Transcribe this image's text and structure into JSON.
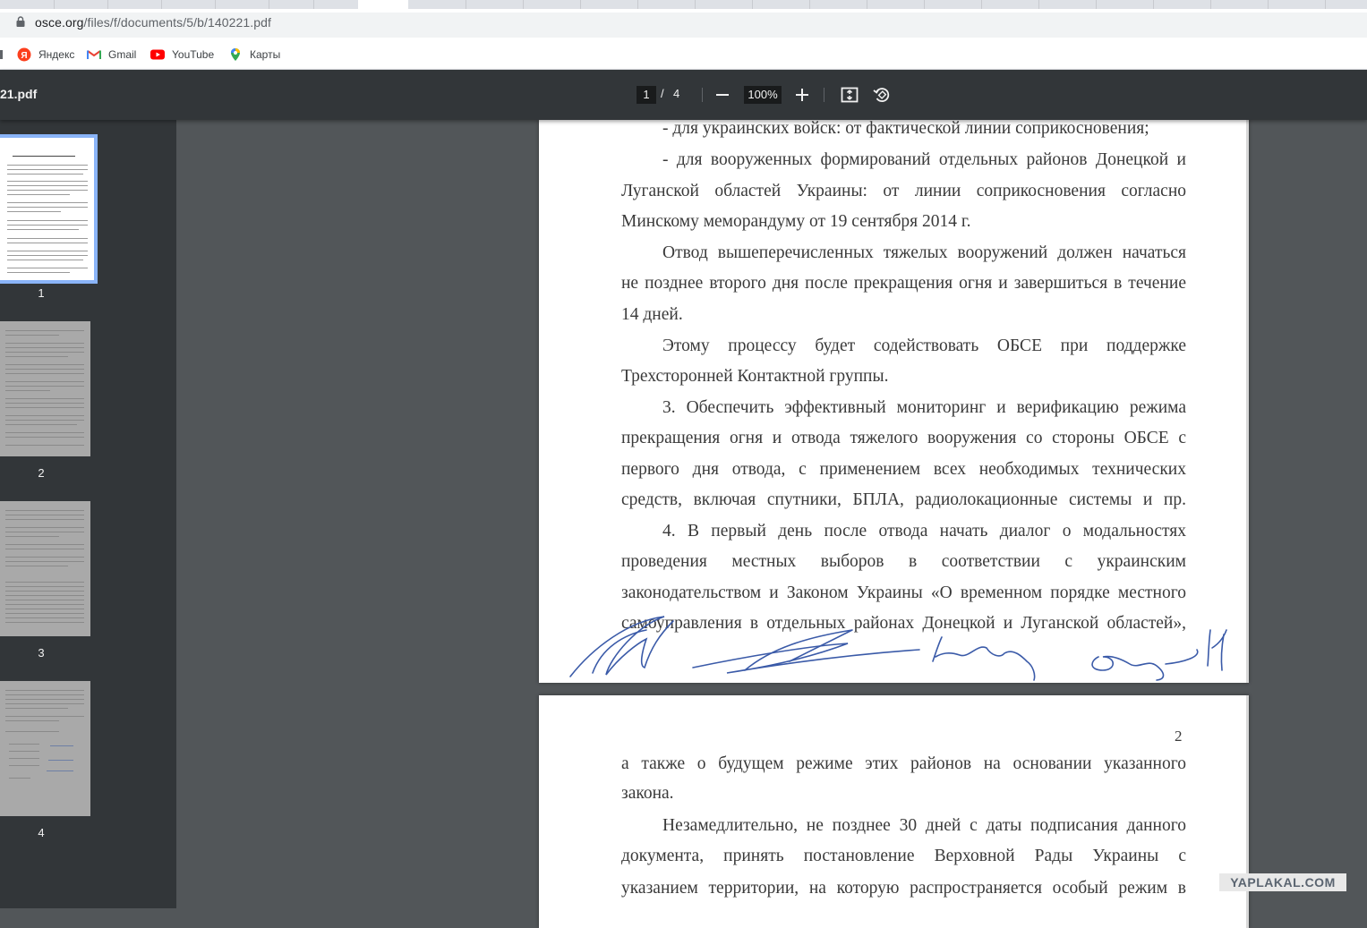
{
  "browser": {
    "url_host": "osce.org",
    "url_path": "/files/f/documents/5/b/140221.pdf",
    "bookmarks": [
      {
        "label": "Яндекс",
        "icon": "yandex-icon"
      },
      {
        "label": "Gmail",
        "icon": "gmail-icon"
      },
      {
        "label": "YouTube",
        "icon": "youtube-icon"
      },
      {
        "label": "Карты",
        "icon": "maps-icon"
      }
    ]
  },
  "toolbar": {
    "title": "21.pdf",
    "current_page": "1",
    "separator": "/",
    "total_pages": "4",
    "zoom": "100%"
  },
  "thumbnails": [
    "1",
    "2",
    "3",
    "4"
  ],
  "page1": {
    "lines": [
      "- для украинских войск: от фактической линии соприкосновения;",
      "- для вооруженных формирований отдельных районов Донецкой и",
      "Луганской областей Украины: от линии соприкосновения согласно",
      "Минскому меморандуму от 19 сентября 2014 г.",
      "Отвод вышеперечисленных тяжелых вооружений должен начаться",
      "не позднее второго дня после прекращения огня и завершиться в течение",
      "14 дней.",
      "Этому процессу будет содействовать ОБСЕ при поддержке",
      "Трехсторонней Контактной группы.",
      "3. Обеспечить эффективный мониторинг и верификацию режима",
      "прекращения огня и отвода тяжелого вооружения со стороны ОБСЕ с",
      "первого дня отвода, с применением всех необходимых технических",
      "средств, включая спутники, БПЛА, радиолокационные системы и пр.",
      "4. В первый день после отвода начать диалог о модальностях",
      "проведения местных выборов в соответствии с украинским",
      "законодательством и Законом Украины «О временном порядке местного",
      "самоуправления в отдельных районах Донецкой и Луганской областей»,"
    ]
  },
  "page2": {
    "page_number": "2",
    "lines": [
      "а также о будущем режиме этих районов на основании указанного",
      "закона.",
      "Незамедлительно, не позднее 30 дней с даты подписания данного",
      "документа, принять постановление Верховной Рады Украины с",
      "указанием территории, на которую распространяется особый режим в"
    ]
  },
  "watermark": "YAPLAKAL.COM"
}
